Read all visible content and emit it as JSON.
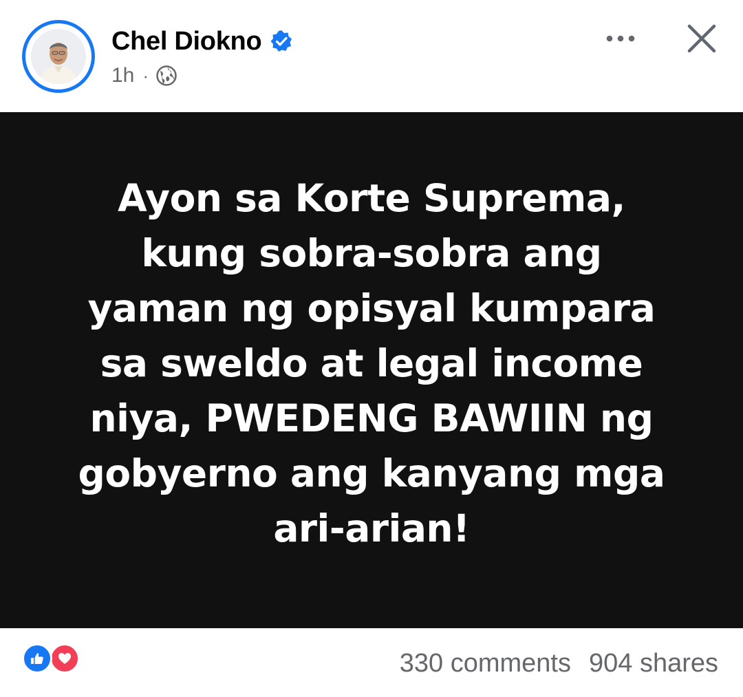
{
  "post": {
    "author": "Chel Diokno",
    "timestamp": "1h",
    "separator": "·",
    "audience_icon": "globe-icon",
    "verified_icon": "verified-badge-icon",
    "image_text_lines": [
      "Ayon sa Korte Suprema,",
      "kung sobra-sobra ang",
      "yaman ng opisyal kumpara",
      "sa sweldo at legal income",
      "niya, PWEDENG BAWIIN ng",
      "gobyerno ang kanyang mga",
      "ari-arian!"
    ],
    "reactions": [
      "like-reaction-icon",
      "love-reaction-icon"
    ],
    "comments": "330 comments",
    "shares": "904 shares"
  },
  "colors": {
    "accent": "#1877f2",
    "love": "#f33e58",
    "image_background": "#111111",
    "secondary_text": "#65676b"
  }
}
